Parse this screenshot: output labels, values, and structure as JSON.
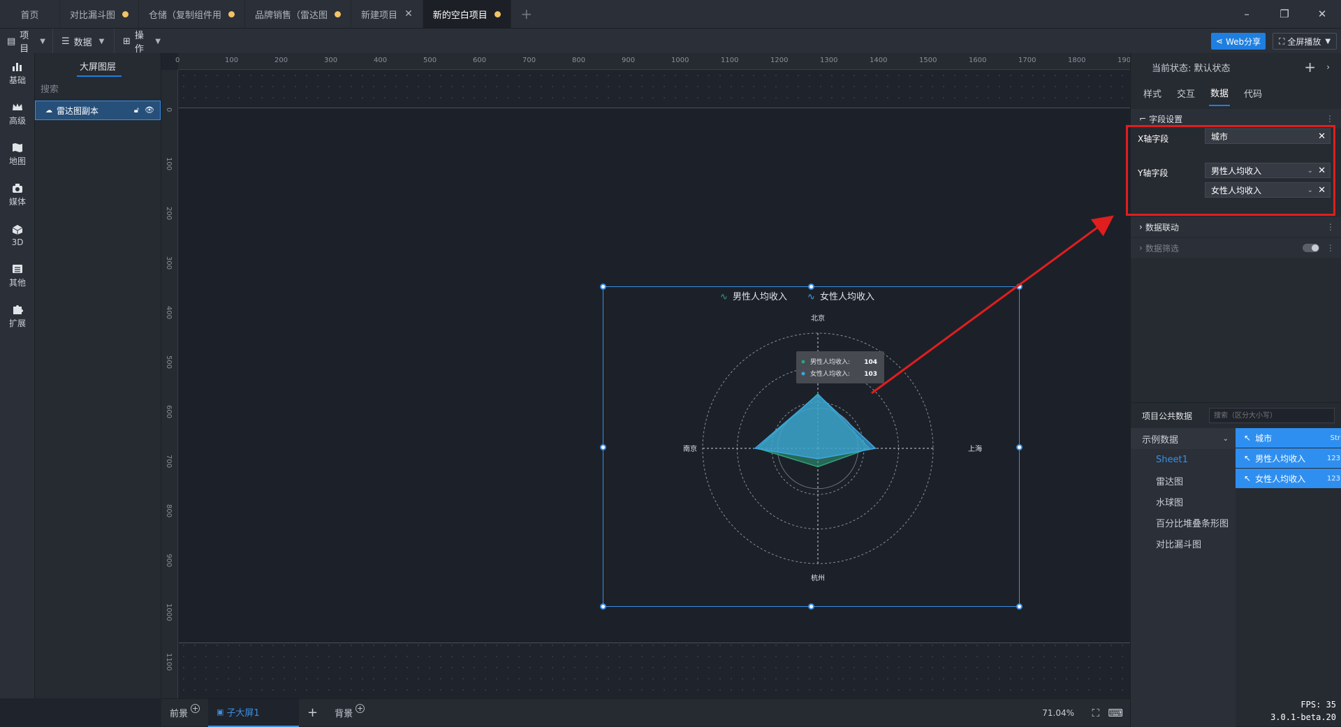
{
  "tabs": [
    {
      "label": "首页",
      "marker": ""
    },
    {
      "label": "对比漏斗图",
      "marker": "dot"
    },
    {
      "label": "仓储（复制组件用",
      "marker": "dot"
    },
    {
      "label": "品牌销售（雷达图",
      "marker": "dot"
    },
    {
      "label": "新建项目",
      "marker": "close"
    },
    {
      "label": "新的空白项目",
      "marker": "dot"
    }
  ],
  "window_controls": {
    "minimize": "–",
    "restore": "❐",
    "close": "✕"
  },
  "toolbar": {
    "project": "项目",
    "data": "数据",
    "operate": "操作",
    "web_share": "Web分享",
    "fullscreen": "全屏播放"
  },
  "rail": [
    {
      "label": "基础",
      "icon": "bar-chart-icon"
    },
    {
      "label": "高级",
      "icon": "crown-icon"
    },
    {
      "label": "地图",
      "icon": "map-icon"
    },
    {
      "label": "媒体",
      "icon": "camera-icon"
    },
    {
      "label": "3D",
      "icon": "cube-icon"
    },
    {
      "label": "其他",
      "icon": "list-icon"
    },
    {
      "label": "扩展",
      "icon": "puzzle-icon"
    }
  ],
  "layers": {
    "title": "大屏图层",
    "search": "搜索",
    "item": "雷达图副本"
  },
  "ruler": {
    "top": [
      "0",
      "100",
      "200",
      "300",
      "400",
      "500",
      "600",
      "700",
      "800",
      "900",
      "1000",
      "1100",
      "1200",
      "1300",
      "1400",
      "1500",
      "1600",
      "1700",
      "1800",
      "1900"
    ],
    "left": [
      "0",
      "100",
      "200",
      "300",
      "400",
      "500",
      "600",
      "700",
      "800",
      "900",
      "1000",
      "1100"
    ]
  },
  "chart_data": {
    "type": "radar",
    "title": "",
    "legend": [
      "男性人均收入",
      "女性人均收入"
    ],
    "legend_position": "top-center",
    "indicators": [
      "北京",
      "上海",
      "杭州",
      "南京"
    ],
    "series": [
      {
        "name": "男性人均收入",
        "color": "#2fa37a",
        "values": [
          104,
          98,
          35,
          115
        ]
      },
      {
        "name": "女性人均收入",
        "color": "#3da6e0",
        "values": [
          103,
          110,
          20,
          120
        ]
      }
    ],
    "tooltip": {
      "rows": [
        {
          "label": "男性人均收入:",
          "value": "104",
          "color": "#2fa37a"
        },
        {
          "label": "女性人均收入:",
          "value": "103",
          "color": "#3da6e0"
        }
      ]
    },
    "max": 220
  },
  "bottombar": {
    "foreground": "前景",
    "sub_screen": "子大屏1",
    "background": "背景",
    "zoom": "71.04%"
  },
  "rpanel": {
    "state": "当前状态:  默认状态",
    "tabs": [
      "样式",
      "交互",
      "数据",
      "代码"
    ],
    "active_tab": "数据",
    "field_settings": "字段设置",
    "x_label": "X轴字段",
    "x_value": "城市",
    "y_label": "Y轴字段",
    "y_values": [
      "男性人均收入",
      "女性人均收入"
    ],
    "data_link": "数据联动",
    "data_filter": "数据筛选",
    "pub_title": "项目公共数据",
    "pub_search_placeholder": "搜索（区分大小写）",
    "tree_root": "示例数据",
    "tree_items": [
      "Sheet1",
      "雷达图",
      "水球图",
      "百分比堆叠条形图",
      "对比漏斗图"
    ],
    "fields": [
      {
        "name": "城市",
        "type": "Str"
      },
      {
        "name": "男性人均收入",
        "type": "123"
      },
      {
        "name": "女性人均收入",
        "type": "123"
      }
    ],
    "fps": "FPS: 35",
    "version": "3.0.1-beta.20"
  },
  "colors": {
    "accent": "#1f7fe0",
    "highlight_box": "#e01e1e"
  }
}
